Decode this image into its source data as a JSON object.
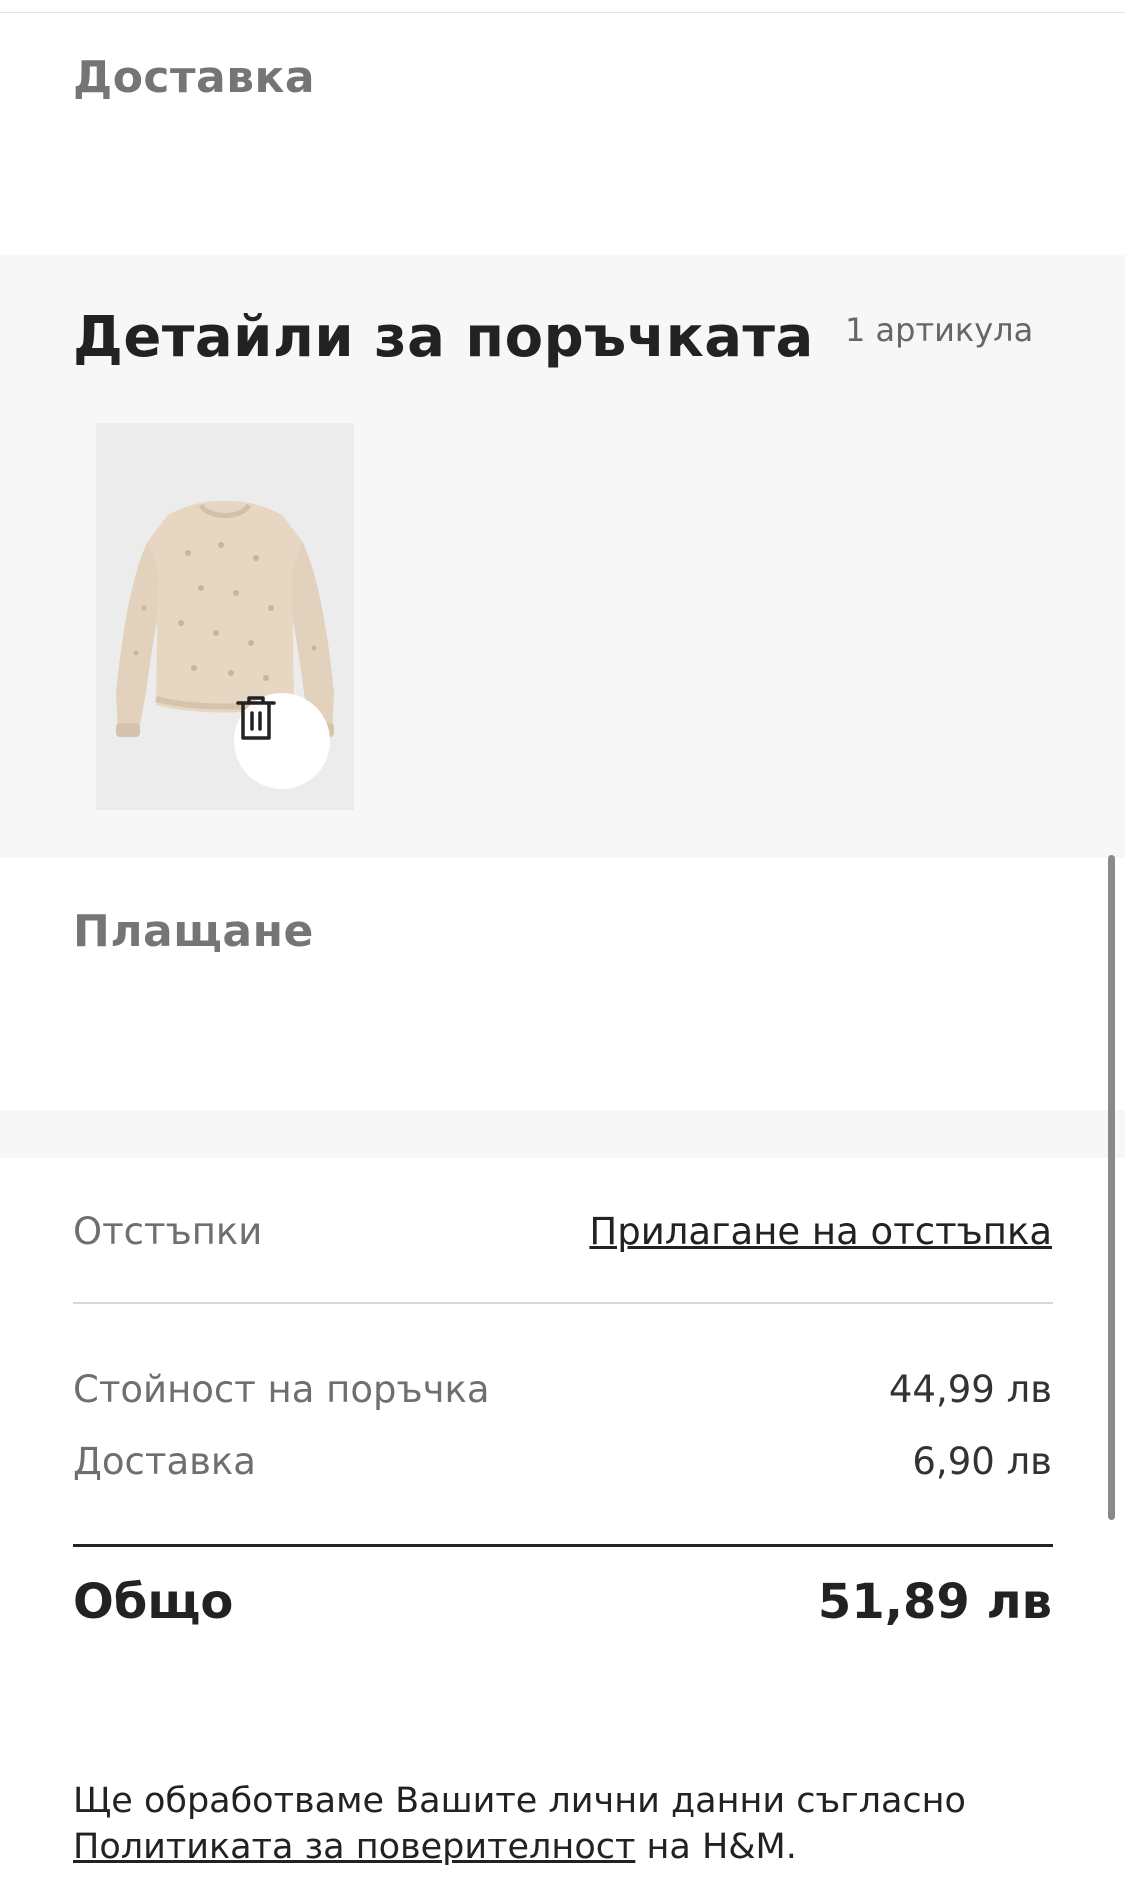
{
  "delivery_section": {
    "title": "Доставка"
  },
  "order_details": {
    "title": "Детайли за поръчката",
    "item_count": "1 артикула",
    "products": [
      {
        "image_icon": "beige-sweater-image",
        "action_icon": "trash-icon"
      }
    ]
  },
  "payment_section": {
    "title": "Плащане"
  },
  "summary": {
    "discounts_label": "Отстъпки",
    "apply_discount_link": "Прилагане на отстъпка",
    "order_value_label": "Стойност на поръчка",
    "order_value": "44,99 лв",
    "delivery_label": "Доставка",
    "delivery_value": "6,90 лв",
    "total_label": "Общо",
    "total_value": "51,89 лв"
  },
  "privacy": {
    "text_before": "Ще обработваме Вашите лични данни съгласно ",
    "link": "Политиката за поверителност",
    "text_after": " на H&M."
  },
  "colors": {
    "panel_background": "#f7f7f7",
    "muted_text": "#757575",
    "primary_text": "#222222",
    "sweater": "#e5d5c1"
  }
}
